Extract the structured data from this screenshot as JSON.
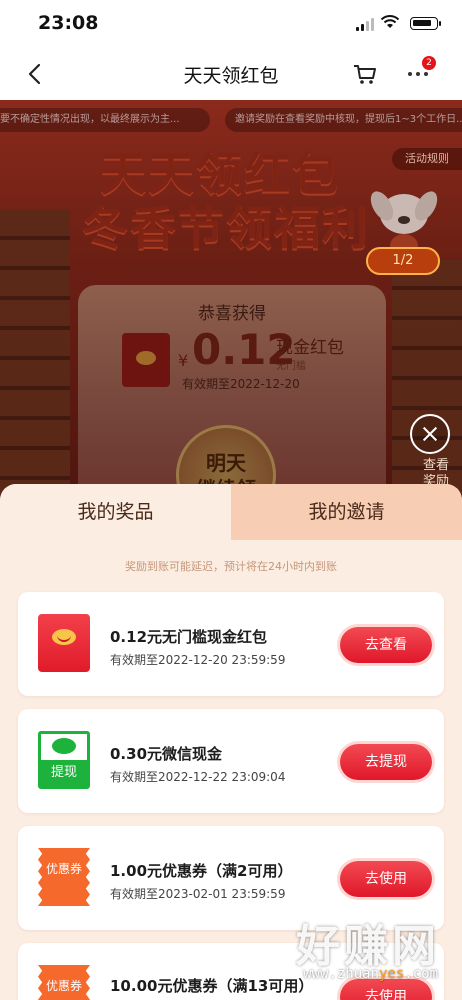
{
  "status_bar": {
    "time": "23:08"
  },
  "nav": {
    "title": "天天领红包",
    "cart_badge": "2"
  },
  "hero": {
    "marquee_left": "要不确定性情况出现，以最终展示为主...",
    "marquee_right": "邀请奖励在查看奖励中核现，提现后1~3个工作日...",
    "video_label": "活动规则",
    "headline_1": "天天领红包",
    "headline_2": "冬香节领福利",
    "pager": "1/2",
    "card": {
      "congrats": "恭喜获得",
      "currency": "¥",
      "amount": "0.12",
      "type": "现金红包",
      "sub": "无门槛",
      "valid": "有效期至2022-12-20",
      "button_line1": "明天",
      "button_line2": "继续领"
    },
    "side_label": "查看奖励"
  },
  "sheet": {
    "tabs": [
      "我的奖品",
      "我的邀请"
    ],
    "notice": "奖励到账可能延迟，预计将在24小时内到账",
    "rewards": [
      {
        "icon": "red-envelope-icon",
        "name": "0.12元无门槛现金红包",
        "expiry": "有效期至2022-12-20 23:59:59",
        "action": "去查看"
      },
      {
        "icon": "wechat-cash-icon",
        "icon_text": "提现",
        "name": "0.30元微信现金",
        "expiry": "有效期至2022-12-22 23:09:04",
        "action": "去提现"
      },
      {
        "icon": "coupon-icon",
        "icon_text": "优惠券",
        "name": "1.00元优惠券（满2可用）",
        "expiry": "有效期至2023-02-01 23:59:59",
        "action": "去使用"
      },
      {
        "icon": "coupon-icon",
        "icon_text": "优惠券",
        "name": "10.00元优惠券（满13可用）",
        "expiry": "",
        "action": "去使用"
      }
    ]
  },
  "watermark": {
    "text": "好赚网",
    "url_a": "www.zhuan",
    "url_b": "yes",
    "url_c": ".com"
  }
}
